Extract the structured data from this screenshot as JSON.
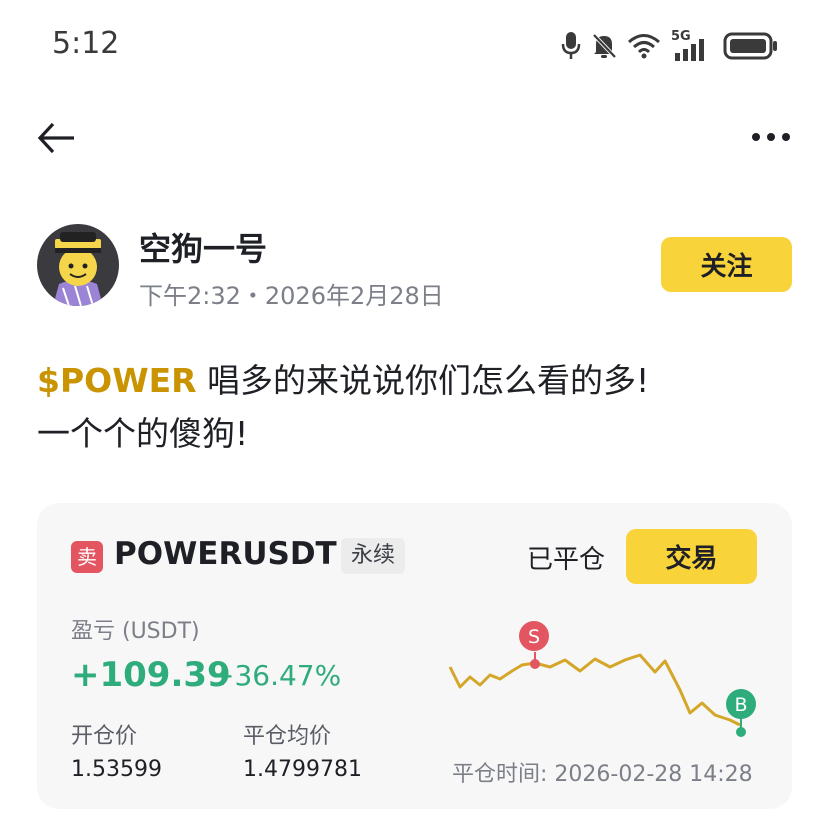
{
  "status_bar": {
    "time": "5:12",
    "network": "5G",
    "icons": [
      "mic-icon",
      "bell-off-icon",
      "wifi-icon",
      "signal-icon",
      "battery-icon"
    ]
  },
  "header": {
    "back_icon": "arrow-left-icon",
    "more_icon": "more-horizontal-icon"
  },
  "post": {
    "author": "空狗一号",
    "time": "下午2:32・2026年2月28日",
    "follow_label": "关注",
    "ticker": "$POWER",
    "text_line1": " 唱多的来说说你们怎么看的多!",
    "text_line2": "一个个的傻狗!"
  },
  "trade_card": {
    "side_badge": "卖",
    "pair": "POWERUSDT",
    "contract_type": "永续",
    "status": "已平仓",
    "trade_label": "交易",
    "pnl_label": "盈亏 (USDT)",
    "pnl_value": "+109.39",
    "pnl_percent": "+36.47%",
    "open_price_label": "开仓价",
    "open_price": "1.53599",
    "close_price_label": "平仓均价",
    "close_price": "1.4799781",
    "close_time": "平仓时间: 2026-02-28 14:28",
    "sell_marker": "S",
    "buy_marker": "B"
  },
  "colors": {
    "accent_yellow": "#f8d33a",
    "ticker_gold": "#c99400",
    "profit_green": "#2eac7c",
    "sell_red": "#e25561",
    "line_gold": "#d4a629"
  }
}
